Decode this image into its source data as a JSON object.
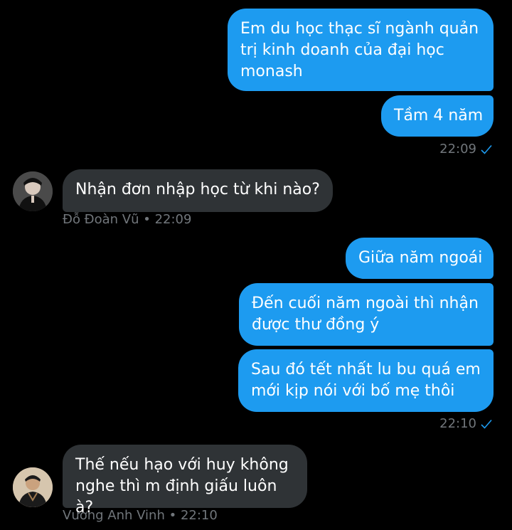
{
  "colors": {
    "outgoing_bubble": "#1d9bf0",
    "incoming_bubble": "#2f3336",
    "meta_text": "#71767b",
    "background": "#000000"
  },
  "messages": {
    "m1": {
      "text": "Em du học thạc sĩ ngành quản trị kinh doanh của đại học monash"
    },
    "m2": {
      "text": "Tầm 4 năm"
    },
    "t1": {
      "time": "22:09",
      "status_icon": "read-check-icon"
    },
    "m3": {
      "text": "Nhận đơn nhập học từ khi nào?",
      "sender": "Đỗ Đoàn Vũ",
      "time": "22:09",
      "meta": "Đỗ Đoàn Vũ • 22:09"
    },
    "m4": {
      "text": "Giữa năm ngoái"
    },
    "m5": {
      "text": "Đến cuối năm ngoài thì nhận được thư đồng ý"
    },
    "m6": {
      "text": "Sau đó tết nhất lu bu quá em mới kịp nói với bố mẹ thôi"
    },
    "t2": {
      "time": "22:10",
      "status_icon": "read-check-icon"
    },
    "m7": {
      "text": "Thế nếu hạo với huy không nghe thì m định giấu luôn à?",
      "sender": "Vương Anh Vinh",
      "time": "22:10",
      "meta": "Vương Anh Vinh • 22:10"
    }
  }
}
